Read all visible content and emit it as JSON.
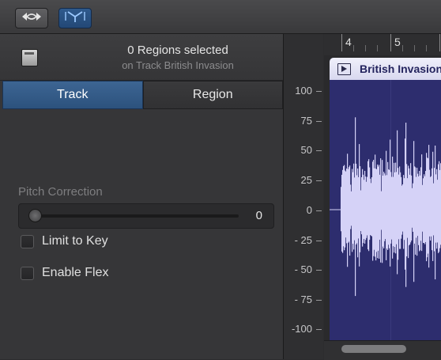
{
  "toolbar": {
    "buttons": [
      {
        "icon": "flex-icon",
        "active": false
      },
      {
        "icon": "pitch-correction-icon",
        "active": true
      }
    ]
  },
  "inspector": {
    "title": "0 Regions selected",
    "subtitle": "on Track British Invasion"
  },
  "tabs": [
    {
      "label": "Track",
      "active": true
    },
    {
      "label": "Region",
      "active": false
    }
  ],
  "pitch_correction": {
    "label": "Pitch Correction",
    "value": "0",
    "level": 0
  },
  "checkboxes": [
    {
      "label": "Limit to Key",
      "checked": false
    },
    {
      "label": "Enable Flex",
      "checked": false
    }
  ],
  "scale": {
    "labels": [
      "100",
      "75",
      "50",
      "25",
      "0",
      "- 25",
      "- 50",
      "- 75",
      "-100"
    ]
  },
  "ruler": {
    "bars": [
      "4",
      "5"
    ]
  },
  "region": {
    "name": "British Invasion",
    "color": "#2d2d6e",
    "wave_color": "#d5d2f7"
  }
}
